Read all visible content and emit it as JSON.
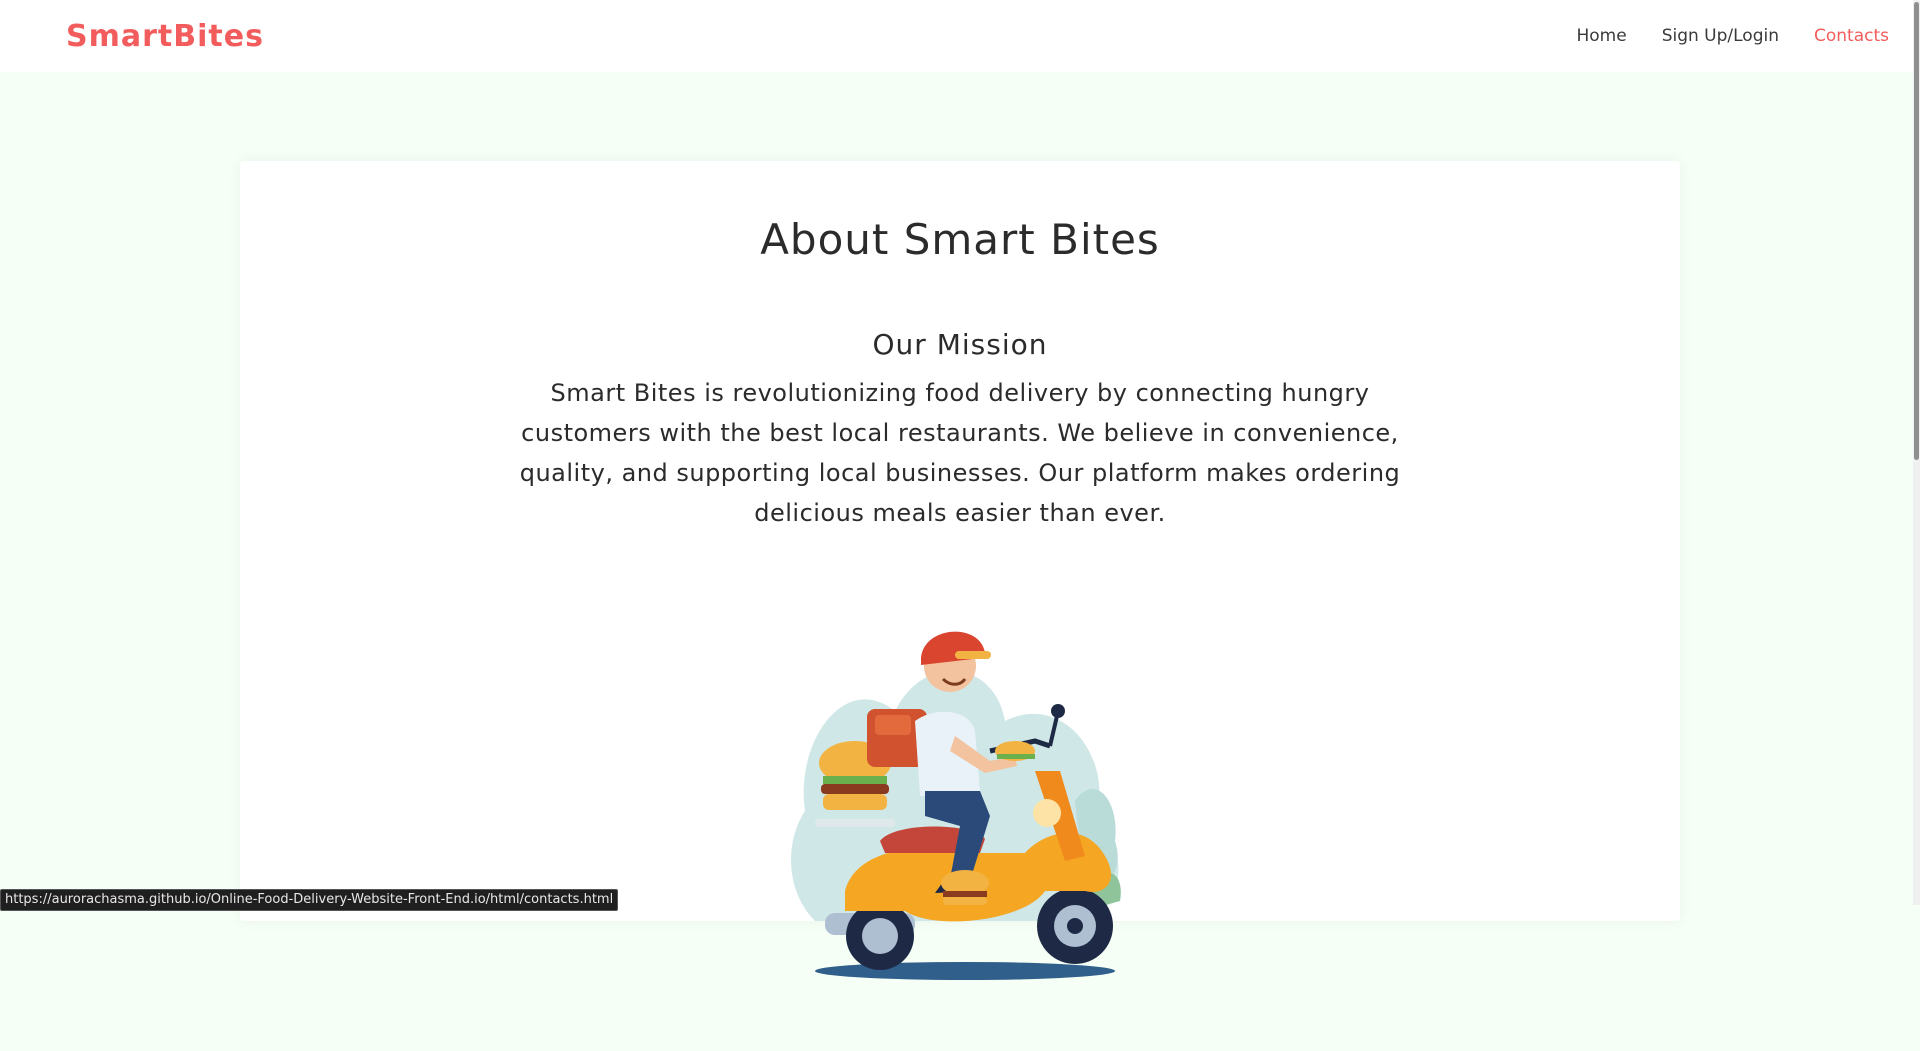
{
  "navbar": {
    "brand": "SmartBites",
    "links": [
      {
        "label": "Home",
        "active": false
      },
      {
        "label": "Sign Up/Login",
        "active": false
      },
      {
        "label": "Contacts",
        "active": true
      }
    ]
  },
  "about": {
    "title": "About Smart Bites",
    "mission_title": "Our Mission",
    "mission_text": "Smart Bites is revolutionizing food delivery by connecting hungry customers with the best local restaurants. We believe in convenience, quality, and supporting local businesses. Our platform makes ordering delicious meals easier than ever."
  },
  "status_bar": {
    "url": "https://aurorachasma.github.io/Online-Food-Delivery-Website-Front-End.io/html/contacts.html"
  },
  "colors": {
    "brand": "#f25c5c",
    "page_background": "#f6fff5",
    "card_background": "#ffffff",
    "text": "#2b2b2b"
  },
  "icons": {
    "illustration": "delivery-scooter-illustration"
  }
}
